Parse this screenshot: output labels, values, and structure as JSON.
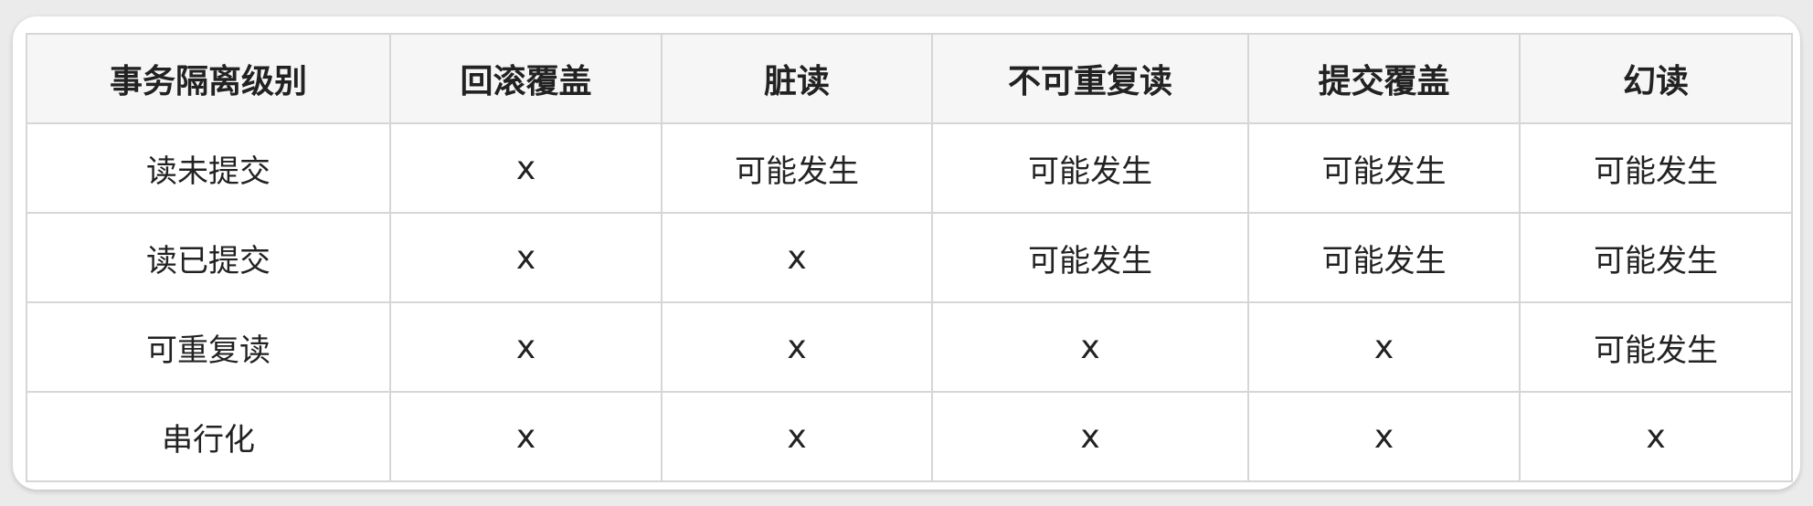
{
  "table": {
    "headers": [
      "事务隔离级别",
      "回滚覆盖",
      "脏读",
      "不可重复读",
      "提交覆盖",
      "幻读"
    ],
    "rows": [
      [
        "读未提交",
        "x",
        "可能发生",
        "可能发生",
        "可能发生",
        "可能发生"
      ],
      [
        "读已提交",
        "x",
        "x",
        "可能发生",
        "可能发生",
        "可能发生"
      ],
      [
        "可重复读",
        "x",
        "x",
        "x",
        "x",
        "可能发生"
      ],
      [
        "串行化",
        "x",
        "x",
        "x",
        "x",
        "x"
      ]
    ]
  }
}
